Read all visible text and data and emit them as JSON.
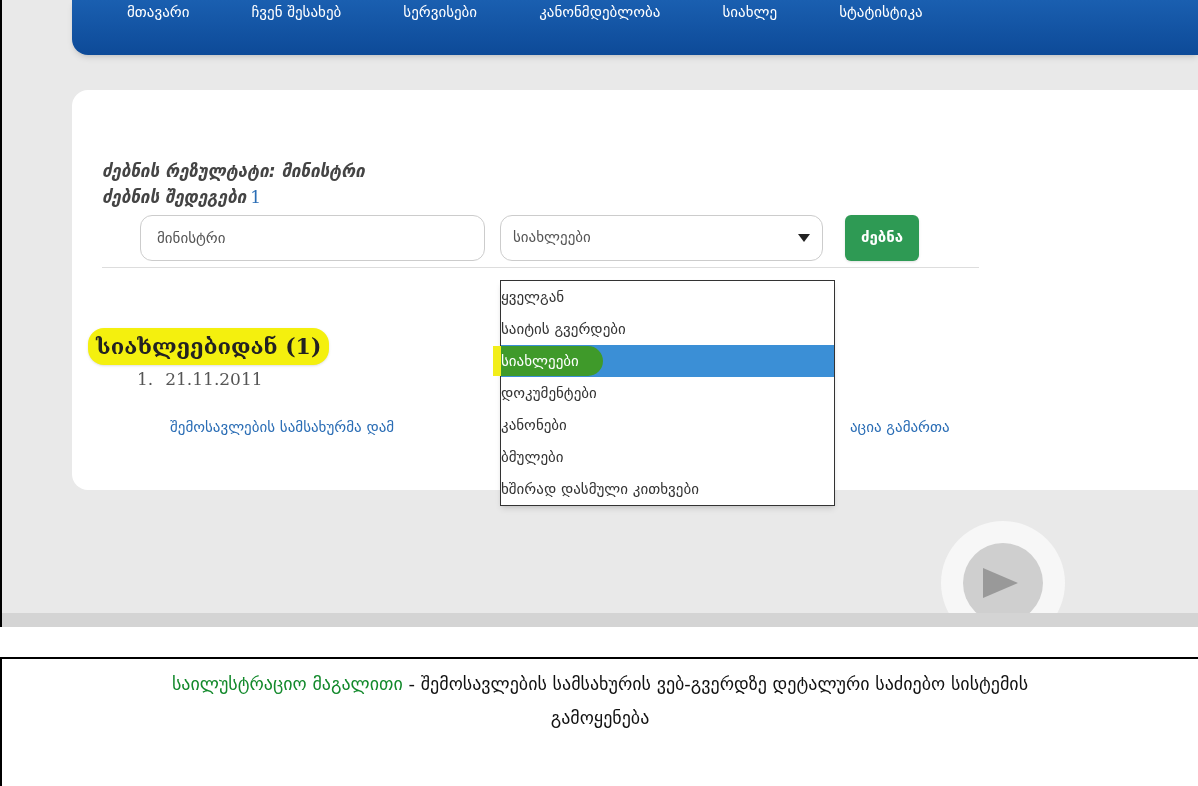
{
  "nav": [
    "მთავარი",
    "ჩვენ შესახებ",
    "სერვისები",
    "კანონმდებლობა",
    "სიახლე",
    "სტატისტიკა"
  ],
  "search": {
    "heading": "ძებნის რეზულტატი: მინისტრი",
    "results_label": "ძებნის შედეგები",
    "results_count": "1",
    "query": "მინისტრი",
    "category": "სიახლეები",
    "button": "ძებნა",
    "options": [
      {
        "label": "ყველგან",
        "selected": false
      },
      {
        "label": "საიტის გვერდები",
        "selected": false
      },
      {
        "label": "სიახლეები",
        "selected": true
      },
      {
        "label": "დოკუმენტები",
        "selected": false
      },
      {
        "label": "კანონები",
        "selected": false
      },
      {
        "label": "ბმულები",
        "selected": false
      },
      {
        "label": "ხშირად დასმული კითხვები",
        "selected": false
      }
    ]
  },
  "results": {
    "heading": "სიახლეებიდან (1)",
    "items": [
      {
        "number": "1.",
        "date": "21.11.2011",
        "link_parts": [
          "შემოსავლების სამსახურმა დამ",
          "აცია გამართა"
        ]
      }
    ]
  },
  "caption": {
    "label": "საილუსტრაციო მაგალითი",
    "text": "- შემოსავლების სამსახურის ვებ-გვერდზე დეტალური საძიებო სისტემის გამოყენება"
  }
}
